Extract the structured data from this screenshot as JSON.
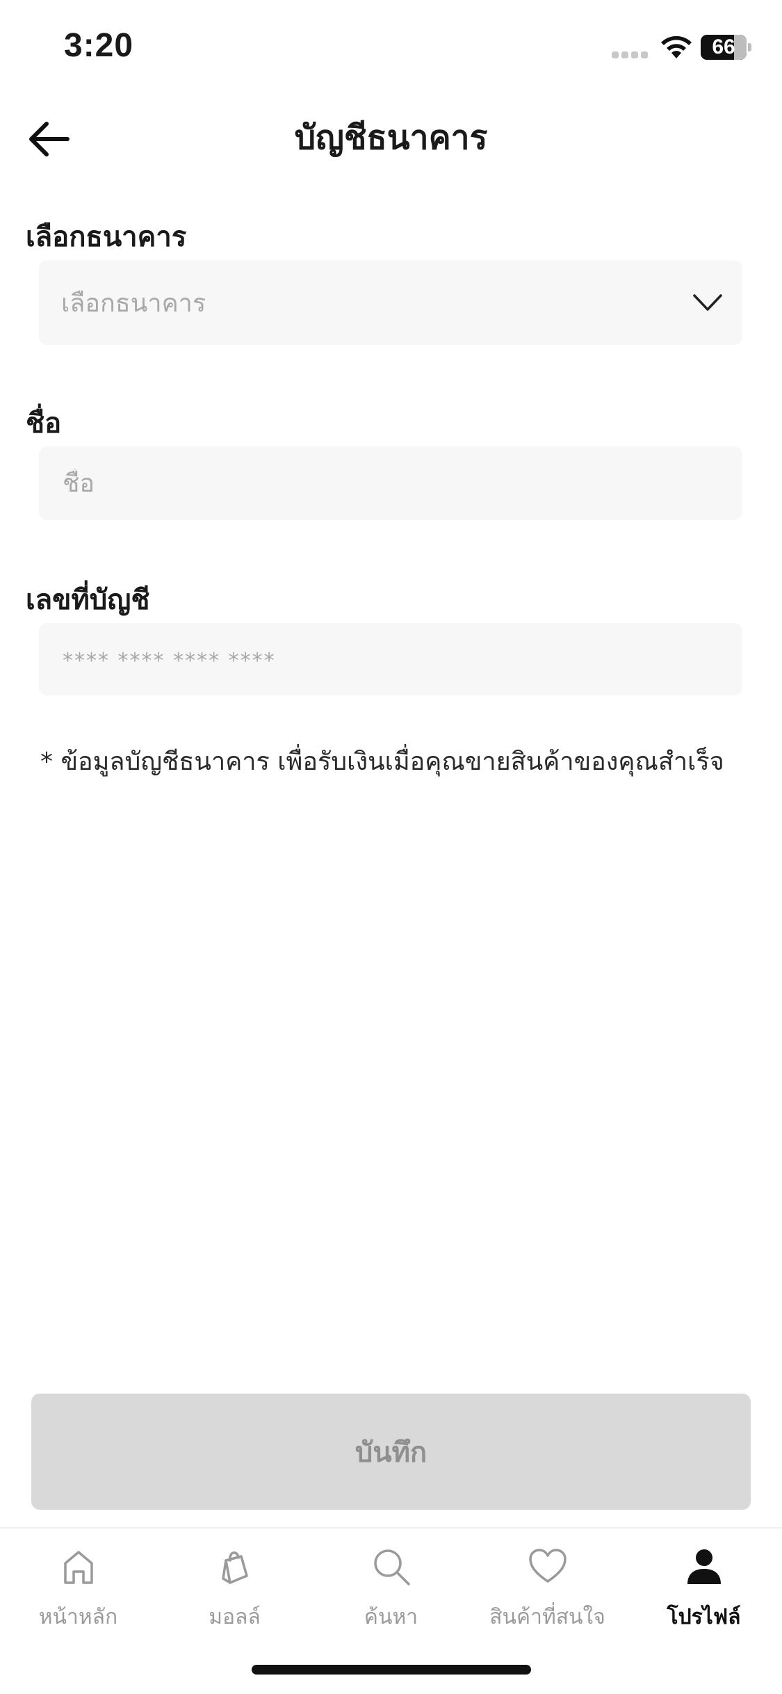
{
  "status_bar": {
    "time": "3:20",
    "battery": "66"
  },
  "header": {
    "title": "บัญชีธนาคาร",
    "back_icon": "arrow-left-icon"
  },
  "form": {
    "bank": {
      "label": "เลือกธนาคาร",
      "placeholder": "เลือกธนาคาร",
      "icon": "chevron-down-icon"
    },
    "name": {
      "label": "ชื่อ",
      "placeholder": "ชื่อ",
      "value": ""
    },
    "account_number": {
      "label": "เลขที่บัญชี",
      "placeholder": "**** **** **** ****",
      "value": ""
    },
    "note": "* ข้อมูลบัญชีธนาคาร เพื่อรับเงินเมื่อคุณขายสินค้าของคุณสำเร็จ"
  },
  "save_button": {
    "label": "บันทึก"
  },
  "tab_bar": {
    "tabs": [
      {
        "label": "หน้าหลัก",
        "icon": "home-icon",
        "active": false
      },
      {
        "label": "มอลล์",
        "icon": "shopping-bag-icon",
        "active": false
      },
      {
        "label": "ค้นหา",
        "icon": "search-icon",
        "active": false
      },
      {
        "label": "สินค้าที่สนใจ",
        "icon": "heart-icon",
        "active": false
      },
      {
        "label": "โปรไฟล์",
        "icon": "profile-icon",
        "active": true
      }
    ]
  },
  "colors": {
    "field_bg": "#f7f7f7",
    "button_disabled_bg": "#d9d9d9",
    "button_disabled_text": "#8f8f8f",
    "tab_inactive": "#9a9a9a",
    "tab_active": "#111111"
  }
}
